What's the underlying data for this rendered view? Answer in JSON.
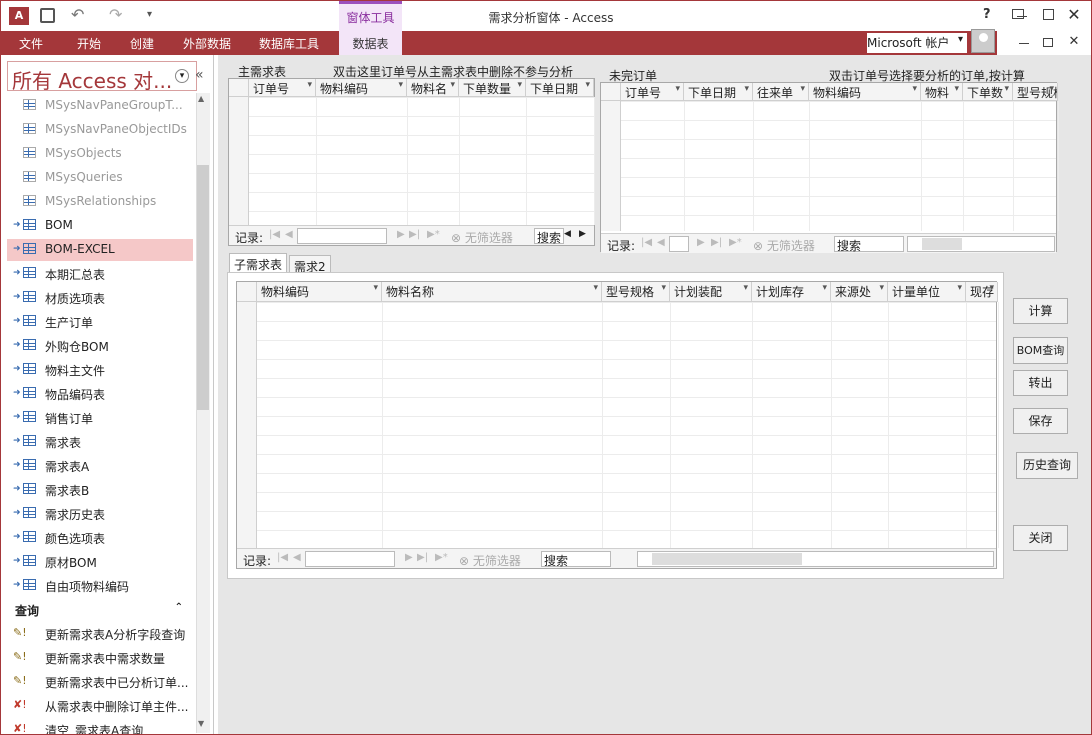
{
  "app": {
    "window_title": "需求分析窗体 - Access",
    "context_tools_label": "窗体工具",
    "account_label": "Microsoft 帐户",
    "account_arrow": "▾",
    "help": "?",
    "qat": {
      "undo": "↶",
      "redo": "↷",
      "more": "▾"
    }
  },
  "ribbon": {
    "tabs": [
      "文件",
      "开始",
      "创建",
      "外部数据",
      "数据库工具",
      "数据表"
    ]
  },
  "nav": {
    "title": "所有 Access 对...",
    "collapse_glyph": "«",
    "menu_glyph": "▾",
    "tables": [
      {
        "label": "MSysNavPaneGroupT...",
        "system": true
      },
      {
        "label": "MSysNavPaneObjectIDs",
        "system": true
      },
      {
        "label": "MSysObjects",
        "system": true
      },
      {
        "label": "MSysQueries",
        "system": true
      },
      {
        "label": "MSysRelationships",
        "system": true
      },
      {
        "label": "BOM",
        "system": false
      },
      {
        "label": "BOM-EXCEL",
        "system": false,
        "selected": true
      },
      {
        "label": "本期汇总表",
        "system": false
      },
      {
        "label": "材质选项表",
        "system": false
      },
      {
        "label": "生产订单",
        "system": false
      },
      {
        "label": "外购仓BOM",
        "system": false
      },
      {
        "label": "物料主文件",
        "system": false
      },
      {
        "label": "物品编码表",
        "system": false
      },
      {
        "label": "销售订单",
        "system": false
      },
      {
        "label": "需求表",
        "system": false
      },
      {
        "label": "需求表A",
        "system": false
      },
      {
        "label": "需求表B",
        "system": false
      },
      {
        "label": "需求历史表",
        "system": false
      },
      {
        "label": "颜色选项表",
        "system": false
      },
      {
        "label": "原材BOM",
        "system": false
      },
      {
        "label": "自由项物料编码",
        "system": false
      }
    ],
    "queries_group": "查询",
    "queries_collapse": "«",
    "queries": [
      {
        "label": "更新需求表A分析字段查询",
        "kind": "update"
      },
      {
        "label": "更新需求表中需求数量",
        "kind": "update"
      },
      {
        "label": "更新需求表中已分析订单...",
        "kind": "update"
      },
      {
        "label": "从需求表中删除订单主件...",
        "kind": "delete"
      },
      {
        "label": "清空_需求表A查询",
        "kind": "delete"
      }
    ]
  },
  "main_demand": {
    "caption": "主需求表",
    "hint": "双击这里订单号从主需求表中删除不参与分析",
    "columns": [
      "订单号",
      "物料编码",
      "物料名",
      "下单数量",
      "下单日期"
    ],
    "record_label": "记录:",
    "filter_label": "无筛选器",
    "search_label": "搜索"
  },
  "open_orders": {
    "caption": "未完订单",
    "hint": "双击订单号选择要分析的订单,按计算",
    "columns": [
      "订单号",
      "下单日期",
      "往来单",
      "物料编码",
      "物料",
      "下单数",
      "型号规格"
    ],
    "record_label": "记录:",
    "filter_label": "无筛选器",
    "search_label": "搜索"
  },
  "sub_tabs": [
    "子需求表",
    "需求2"
  ],
  "sub_demand": {
    "columns": [
      "物料编码",
      "物料名称",
      "型号规格",
      "计划装配",
      "计划库存",
      "来源处",
      "计量单位",
      "现存"
    ],
    "record_label": "记录:",
    "filter_label": "无筛选器",
    "search_label": "搜索"
  },
  "buttons": {
    "calc": "计算",
    "bom_query": "BOM查询",
    "export": "转出",
    "save": "保存",
    "history": "历史查询",
    "close": "关闭"
  },
  "colors": {
    "accent": "#a4373a",
    "context": "#9c4fbd",
    "selected": "#f5c8c8"
  }
}
